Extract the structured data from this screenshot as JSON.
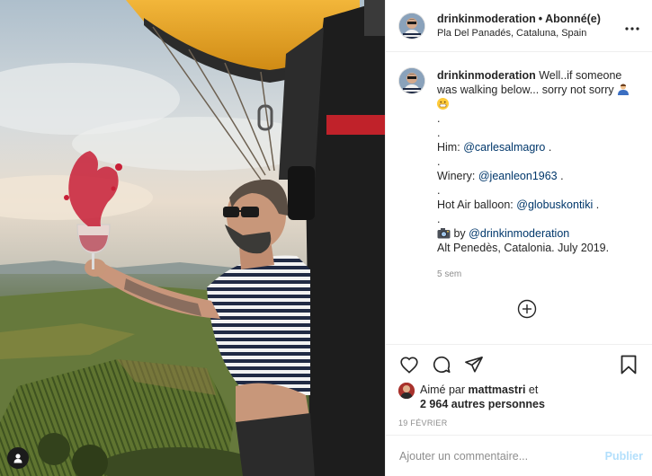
{
  "header": {
    "username": "drinkinmoderation",
    "separator": "•",
    "follow_state": "Abonné(e)",
    "location": "Pla Del Panadés, Cataluna, Spain"
  },
  "caption": {
    "username": "drinkinmoderation",
    "line1": "Well..if someone was walking below... sorry not sorry",
    "dot1": ".",
    "dot2": ".",
    "him_label": "Him:",
    "him_mention": "@carlesalmagro",
    "dot3": ".",
    "winery_label": "Winery:",
    "winery_mention": "@jeanleon1963",
    "dot4": ".",
    "balloon_label": "Hot Air balloon:",
    "balloon_mention": "@globuskontiki",
    "dot5": ".",
    "photo_by_label": "by",
    "photo_by_mention": "@drinkinmoderation",
    "place_line": "Alt Penedès, Catalonia. July 2019.",
    "trailing_dot": ".",
    "time_ago": "5 sem"
  },
  "likes": {
    "prefix": "Aimé par",
    "user": "mattmastri",
    "conj": "et",
    "others": "2 964 autres personnes"
  },
  "date": "19 FÉVRIER",
  "comment_box": {
    "placeholder": "Ajouter un commentaire...",
    "publish_label": "Publier"
  },
  "colors": {
    "mention": "#00376b",
    "secondary_text": "#8e8e8e",
    "publish_disabled": "#b2dffc",
    "balloon": "#e8a31c"
  },
  "icons": [
    "user-tag-icon",
    "more-options-icon",
    "load-more-comments-icon",
    "heart-icon",
    "comment-icon",
    "share-icon",
    "bookmark-icon",
    "camera-emoji-icon",
    "grin-emoji-icon",
    "person-emoji-icon"
  ]
}
